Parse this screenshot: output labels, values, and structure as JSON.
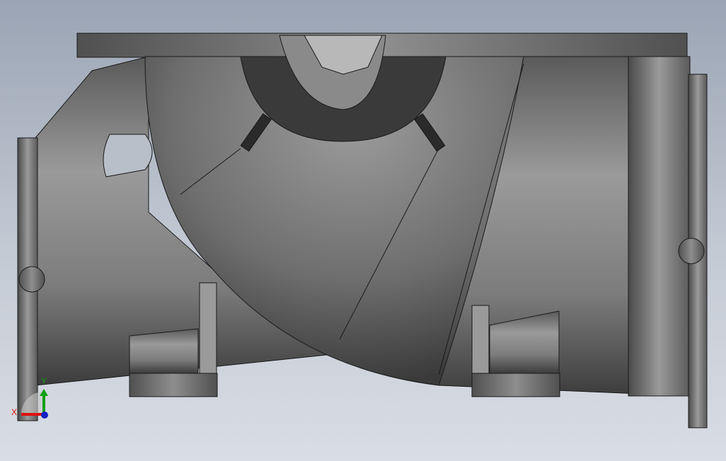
{
  "viewport": {
    "model": "pump-casing",
    "colors": {
      "background_top": "#9aa4b4",
      "background_bottom": "#d9dde4",
      "part": "#7a7a7a"
    }
  },
  "triad": {
    "x_label": "X",
    "y_label": "Y",
    "colors": {
      "x": "#e01010",
      "y": "#10a010",
      "z": "#1020c0"
    }
  }
}
